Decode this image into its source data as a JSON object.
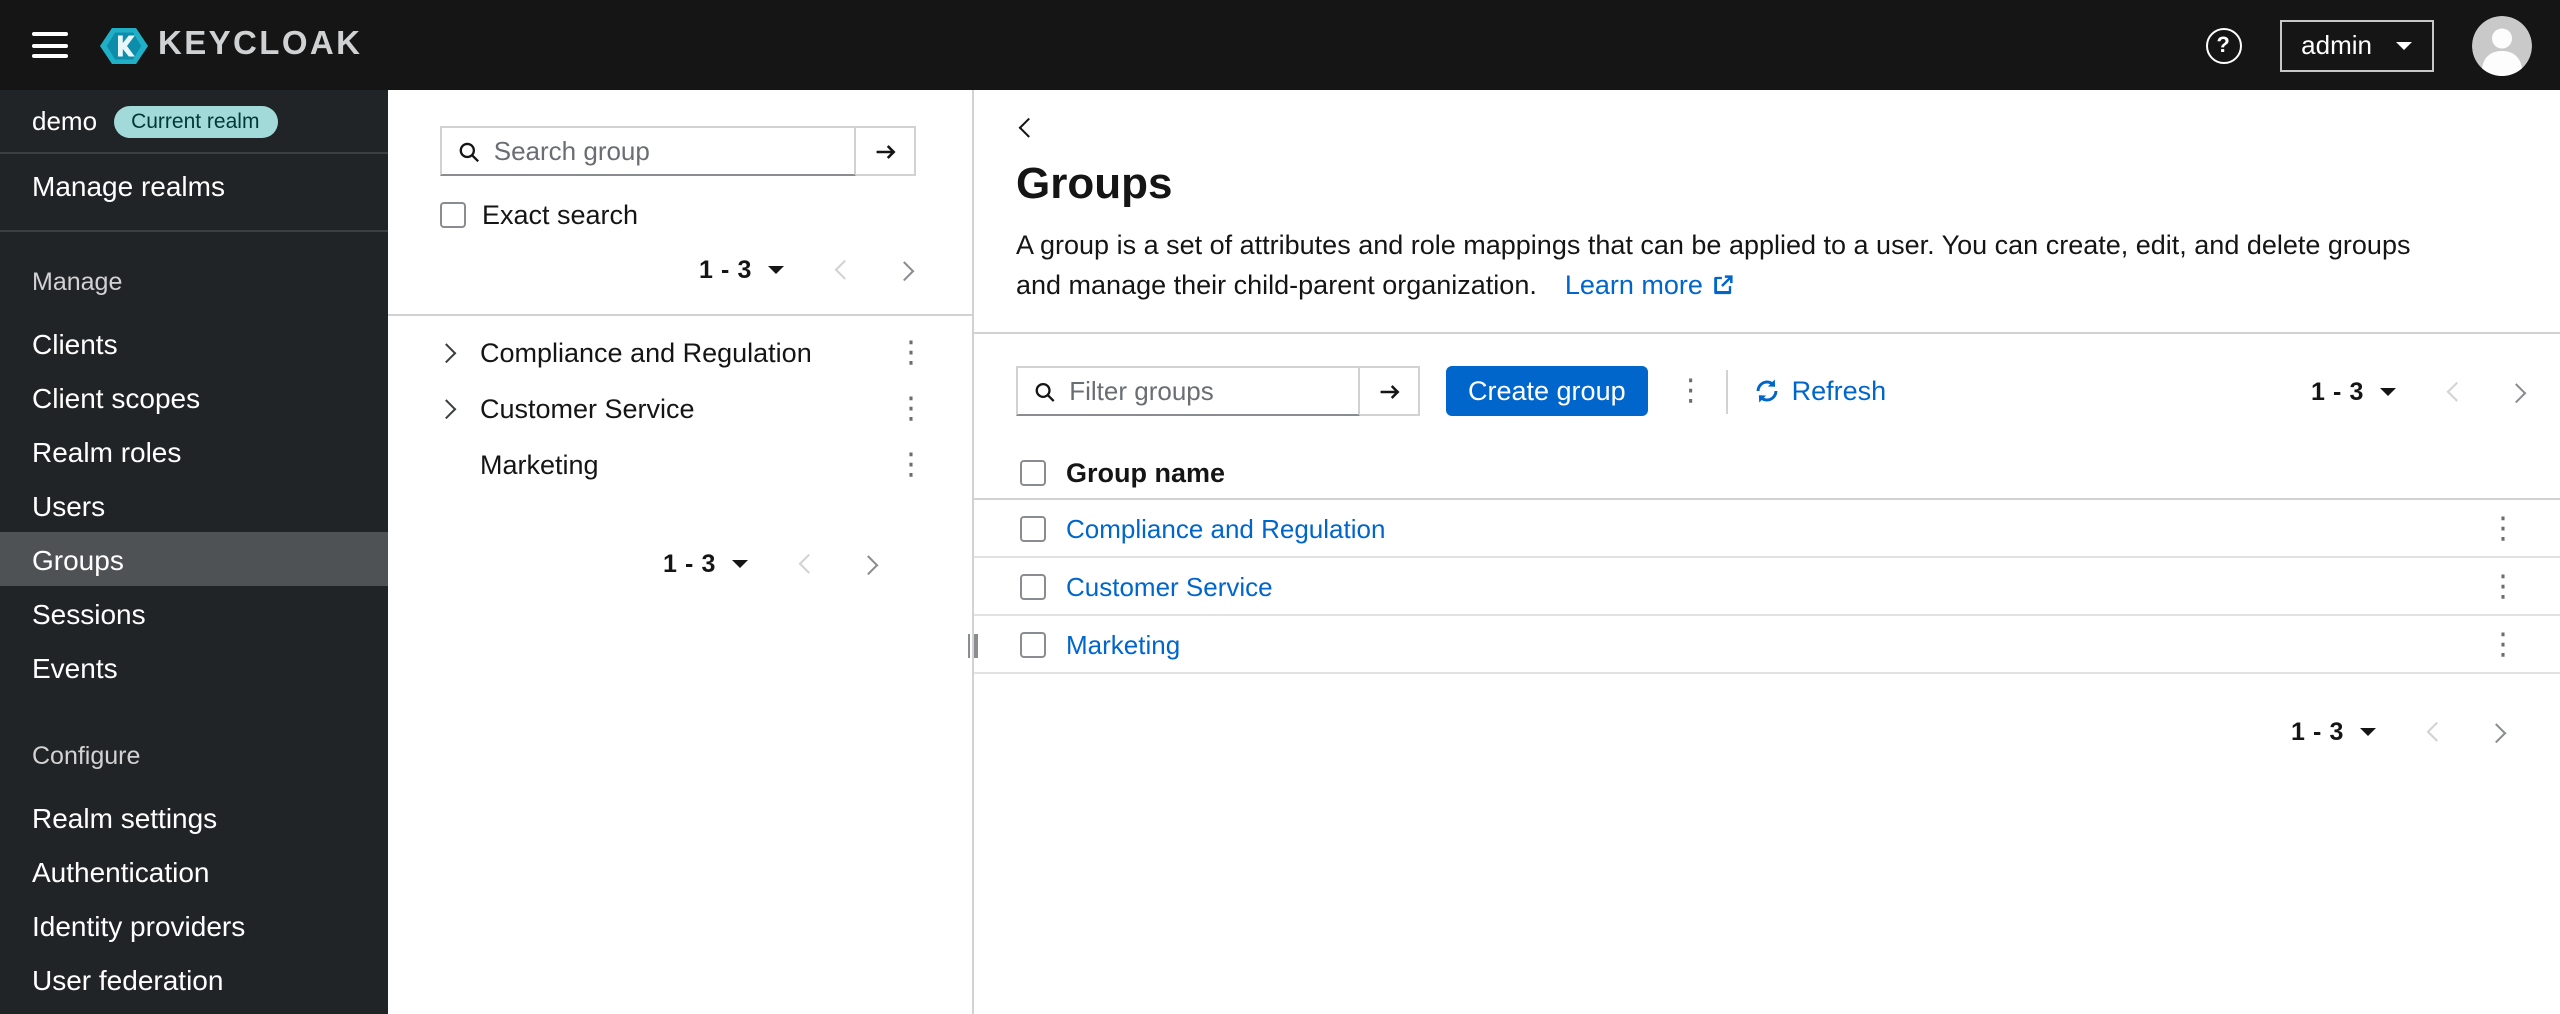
{
  "masthead": {
    "brand": "KEYCLOAK",
    "user": "admin"
  },
  "sidebar": {
    "realm_name": "demo",
    "realm_badge": "Current realm",
    "manage_realms_label": "Manage realms",
    "sections": [
      {
        "label": "Manage",
        "items": [
          {
            "label": "Clients"
          },
          {
            "label": "Client scopes"
          },
          {
            "label": "Realm roles"
          },
          {
            "label": "Users"
          },
          {
            "label": "Groups",
            "active": true
          },
          {
            "label": "Sessions"
          },
          {
            "label": "Events"
          }
        ]
      },
      {
        "label": "Configure",
        "items": [
          {
            "label": "Realm settings"
          },
          {
            "label": "Authentication"
          },
          {
            "label": "Identity providers"
          },
          {
            "label": "User federation"
          }
        ]
      }
    ]
  },
  "tree": {
    "search_placeholder": "Search group",
    "exact_search_label": "Exact search",
    "pagination_top": {
      "range": "1 - 3"
    },
    "pagination_bottom": {
      "range": "1 - 3"
    },
    "items": [
      {
        "label": "Compliance and Regulation",
        "expandable": true
      },
      {
        "label": "Customer Service",
        "expandable": true
      },
      {
        "label": "Marketing",
        "expandable": false
      }
    ]
  },
  "main": {
    "title": "Groups",
    "description": "A group is a set of attributes and role mappings that can be applied to a user. You can create, edit, and delete groups and manage their child-parent organization.",
    "learn_more_label": "Learn more",
    "toolbar": {
      "filter_placeholder": "Filter groups",
      "create_button_label": "Create group",
      "refresh_label": "Refresh",
      "pagination": {
        "range": "1 - 3"
      }
    },
    "table": {
      "name_header": "Group name",
      "rows": [
        {
          "name": "Compliance and Regulation"
        },
        {
          "name": "Customer Service"
        },
        {
          "name": "Marketing"
        }
      ]
    },
    "pagination_bottom": {
      "range": "1 - 3"
    }
  },
  "icons": {
    "kebab": "⋮",
    "help": "?"
  },
  "colors": {
    "primary": "#0066cc",
    "link": "#0066cc",
    "masthead_bg": "#151515",
    "sidebar_bg": "#212427",
    "active_nav_bg": "#4f5255",
    "realm_badge_bg": "#a2d9d9",
    "realm_badge_text": "#003737",
    "border": "#d2d2d2"
  }
}
